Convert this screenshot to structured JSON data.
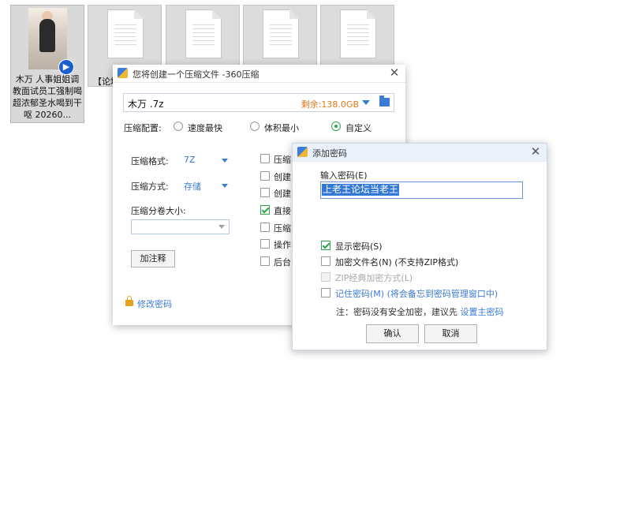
{
  "desktop": {
    "video_file": {
      "caption": "木万 人事姐姐调教面试员工强制喝超浓郁圣水喝到干呕  20260...",
      "badge_icon": "video-play-icon"
    },
    "doc_files": [
      {
        "caption": "【论坛"
      },
      {
        "caption": ""
      },
      {
        "caption": ""
      },
      {
        "caption": ""
      }
    ]
  },
  "compress_dialog": {
    "title": "您将创建一个压缩文件 -360压缩",
    "path": "木万 .7z",
    "free_space": "剩余:138.0GB",
    "config_label": "压缩配置:",
    "config_options": [
      {
        "label": "速度最快",
        "selected": false
      },
      {
        "label": "体积最小",
        "selected": false
      },
      {
        "label": "自定义",
        "selected": true
      }
    ],
    "format_label": "压缩格式:",
    "format_value": "7Z",
    "method_label": "压缩方式:",
    "method_value": "存储",
    "split_label": "压缩分卷大小:",
    "split_value": "",
    "comment_button": "加注释",
    "change_password": "修改密码",
    "options": [
      {
        "label": "压缩",
        "checked": false
      },
      {
        "label": "创建",
        "checked": false
      },
      {
        "label": "创建",
        "checked": false
      },
      {
        "label": "直接",
        "checked": true
      },
      {
        "label": "压缩",
        "checked": false
      },
      {
        "label": "操作",
        "checked": false
      },
      {
        "label": "后台",
        "checked": false
      }
    ]
  },
  "password_dialog": {
    "title": "添加密码",
    "input_label": "输入密码(E)",
    "password_value": "上老王论坛当老王",
    "options": [
      {
        "label": "显示密码(S)",
        "checked": true,
        "disabled": false
      },
      {
        "label": "加密文件名(N) (不支持ZIP格式)",
        "checked": false,
        "disabled": false
      },
      {
        "label": "ZIP经典加密方式(L)",
        "checked": false,
        "disabled": true
      },
      {
        "label": "记住密码(M) (将会备忘到密码管理窗口中)",
        "checked": false,
        "disabled": false
      }
    ],
    "note_prefix": "注：密码没有安全加密，建议先 ",
    "note_link": "设置主密码",
    "ok_button": "确认",
    "cancel_button": "取消"
  },
  "colors": {
    "accent_blue": "#3a7bd5",
    "check_green": "#2ca64a",
    "free_space_orange": "#e07a1a"
  }
}
